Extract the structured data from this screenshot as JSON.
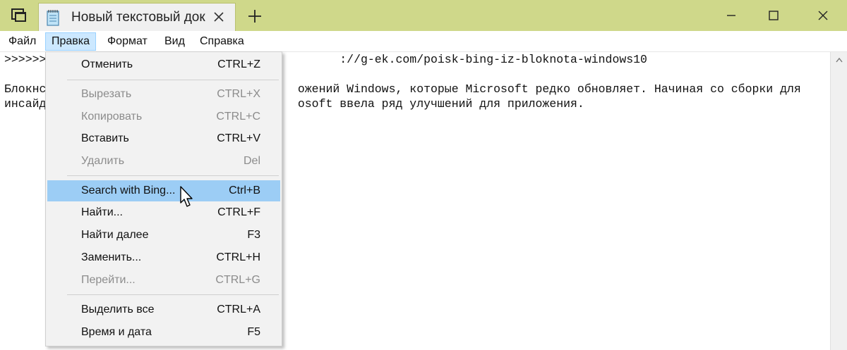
{
  "window": {
    "tab_title": "Новый текстовый док",
    "colors": {
      "titlebar": "#cfd88a",
      "menu_active": "#cce8ff",
      "highlight": "#9ccdf5"
    }
  },
  "menubar": {
    "items": [
      {
        "label": "Файл"
      },
      {
        "label": "Правка"
      },
      {
        "label": "Формат"
      },
      {
        "label": "Вид"
      },
      {
        "label": "Справка"
      }
    ]
  },
  "editor": {
    "lines": [
      ">>>>>>                                          ://g-ek.com/poisk-bing-iz-bloknota-windows10",
      "",
      "Блокнс                                    ожений Windows, которые Microsoft редко обновляет. Начиная со сборки для",
      "инсайд                                    osoft ввела ряд улучшений для приложения."
    ]
  },
  "edit_menu": {
    "items": [
      {
        "label": "Отменить",
        "shortcut": "CTRL+Z",
        "enabled": true
      },
      {
        "label": "Вырезать",
        "shortcut": "CTRL+X",
        "enabled": false
      },
      {
        "label": "Копировать",
        "shortcut": "CTRL+C",
        "enabled": false
      },
      {
        "label": "Вставить",
        "shortcut": "CTRL+V",
        "enabled": true
      },
      {
        "label": "Удалить",
        "shortcut": "Del",
        "enabled": false
      },
      {
        "label": "Search with Bing...",
        "shortcut": "Ctrl+B",
        "enabled": true,
        "highlighted": true
      },
      {
        "label": "Найти...",
        "shortcut": "CTRL+F",
        "enabled": true
      },
      {
        "label": "Найти далее",
        "shortcut": "F3",
        "enabled": true
      },
      {
        "label": "Заменить...",
        "shortcut": "CTRL+H",
        "enabled": true
      },
      {
        "label": "Перейти...",
        "shortcut": "CTRL+G",
        "enabled": false
      },
      {
        "label": "Выделить все",
        "shortcut": "CTRL+A",
        "enabled": true
      },
      {
        "label": "Время и дата",
        "shortcut": "F5",
        "enabled": true
      }
    ]
  }
}
